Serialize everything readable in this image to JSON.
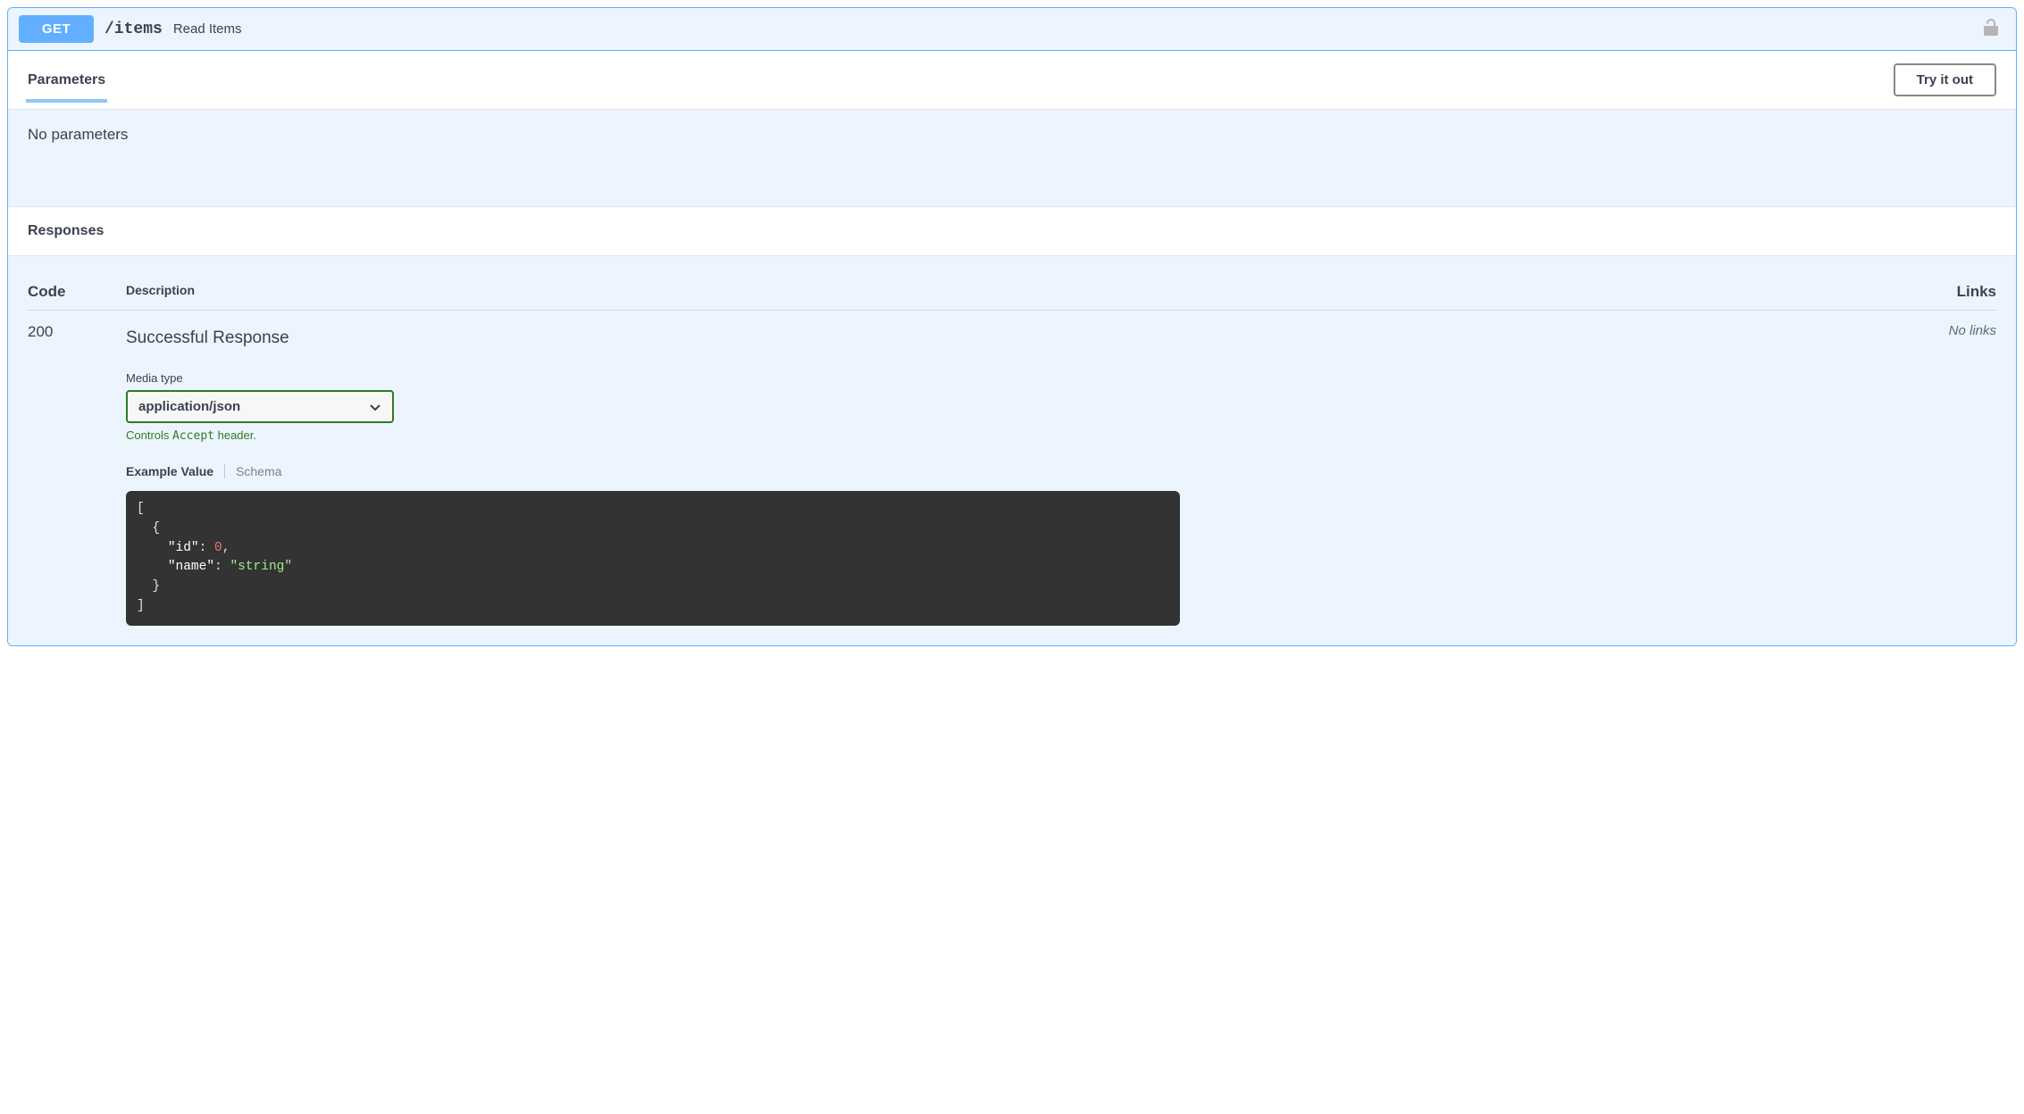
{
  "endpoint": {
    "method": "GET",
    "path": "/items",
    "summary": "Read Items"
  },
  "sections": {
    "parameters_label": "Parameters",
    "responses_label": "Responses",
    "try_it_out": "Try it out",
    "no_parameters": "No parameters"
  },
  "resp_headers": {
    "code": "Code",
    "description": "Description",
    "links": "Links"
  },
  "response": {
    "code": "200",
    "description": "Successful Response",
    "no_links": "No links",
    "media_type_label": "Media type",
    "media_type_value": "application/json",
    "accept_note_prefix": "Controls ",
    "accept_note_mono": "Accept",
    "accept_note_suffix": " header.",
    "tab_example": "Example Value",
    "tab_schema": "Schema",
    "example": {
      "id_key": "\"id\"",
      "id_value": "0",
      "name_key": "\"name\"",
      "name_value": "\"string\""
    }
  }
}
